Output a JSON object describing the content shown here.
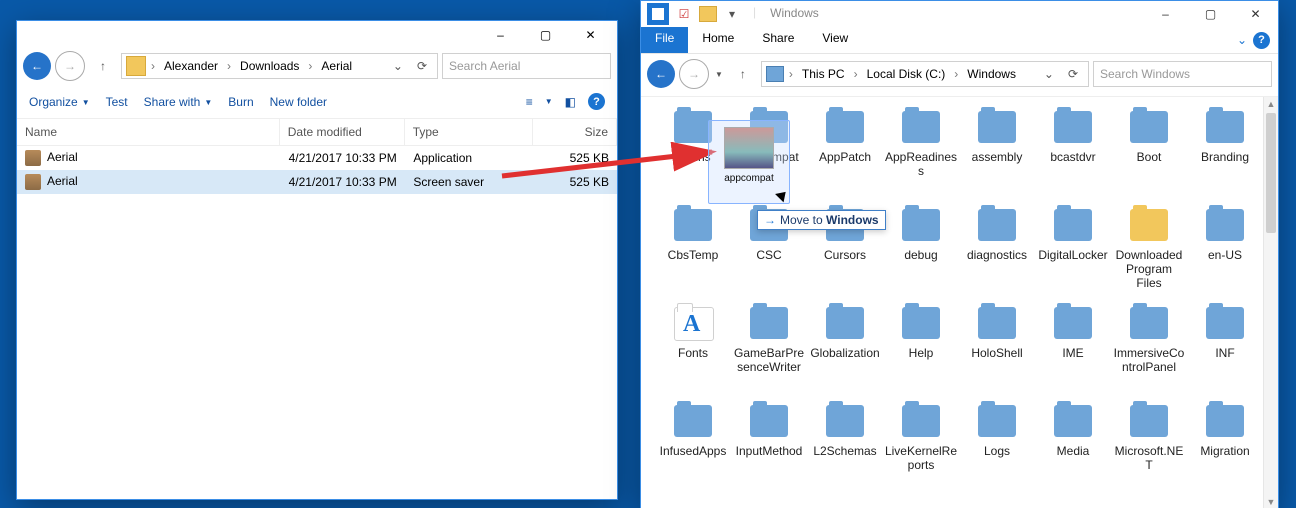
{
  "window1": {
    "wc_minimize": "–",
    "wc_maximize": "▢",
    "wc_close": "✕",
    "nav_back": "←",
    "nav_fwd": "→",
    "nav_up": "↑",
    "crumb_sep_initial": "›",
    "crumbs": [
      "Alexander",
      "Downloads",
      "Aerial"
    ],
    "crumb_sep": "›",
    "refresh": "⟳",
    "search_placeholder": "Search Aerial",
    "toolbar": {
      "organize": "Organize",
      "test": "Test",
      "share_with": "Share with",
      "burn": "Burn",
      "new_folder": "New folder",
      "view_icon": "≡",
      "layout_icon": "◧",
      "help": "?"
    },
    "columns": {
      "name": "Name",
      "date": "Date modified",
      "type": "Type",
      "size": "Size"
    },
    "rows": [
      {
        "name": "Aerial",
        "date": "4/21/2017 10:33 PM",
        "type": "Application",
        "size": "525 KB",
        "selected": false
      },
      {
        "name": "Aerial",
        "date": "4/21/2017 10:33 PM",
        "type": "Screen saver",
        "size": "525 KB",
        "selected": true
      }
    ]
  },
  "window2": {
    "title": "Windows",
    "ribbon_file": "File",
    "ribbon_tabs": [
      "Home",
      "Share",
      "View"
    ],
    "wc_minimize": "–",
    "wc_maximize": "▢",
    "wc_close": "✕",
    "nav_back": "←",
    "nav_fwd": "→",
    "nav_up": "↑",
    "refresh": "⟳",
    "qat_chev": "▾",
    "qat_sep": "|",
    "ribbon_chev": "⌄",
    "search_placeholder": "Search Windows",
    "crumbs": [
      "This PC",
      "Local Disk (C:)",
      "Windows"
    ],
    "crumb_sep": "›",
    "folders": [
      "addins",
      "appcompat",
      "AppPatch",
      "AppReadiness",
      "assembly",
      "bcastdvr",
      "Boot",
      "Branding",
      "CbsTemp",
      "CSC",
      "Cursors",
      "debug",
      "diagnostics",
      "DigitalLocker",
      "Downloaded Program Files",
      "en-US",
      "Fonts",
      "GameBarPresenceWriter",
      "Globalization",
      "Help",
      "HoloShell",
      "IME",
      "ImmersiveControlPanel",
      "INF",
      "InfusedApps",
      "InputMethod",
      "L2Schemas",
      "LiveKernelReports",
      "Logs",
      "Media",
      "Microsoft.NET",
      "Migration"
    ],
    "yellow_folders": [
      "Downloaded Program Files"
    ],
    "fonts_folder": "Fonts"
  },
  "annotation": {
    "drag_label": "appcompat",
    "drop_tip_prefix": "Move to ",
    "drop_tip_target": "Windows",
    "drop_tip_arrow": "→"
  }
}
